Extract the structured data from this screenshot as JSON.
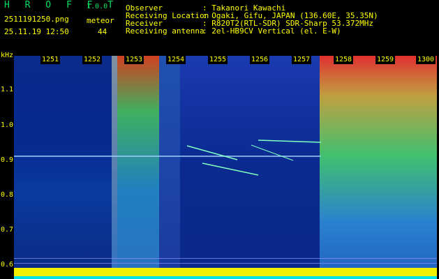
{
  "header": {
    "app_title": "H R O F F T",
    "version": "1.0.0",
    "filename": "2511191250.png",
    "mode": "meteor",
    "datetime": "25.11.19 12:50",
    "count": "44",
    "observer_label": "Observer",
    "observer_value": ": Takanori Kawachi",
    "location_label": "Receiving Location",
    "location_value": ": Ogaki, Gifu, JAPAN (136.60E, 35.35N)",
    "receiver_label": "Receiver",
    "receiver_value": ": R820T2(RTL-SDR) SDR-Sharp 53.372MHz",
    "antenna_label": "Receiving antenna",
    "antenna_value": ": 2el-HB9CV Vertical (el. E-W)"
  },
  "axis": {
    "unit": "kHz",
    "y_ticks": [
      "1.1",
      "1.0",
      "0.9",
      "0.8",
      "0.7",
      "0.6"
    ],
    "time_ticks": [
      "1251",
      "1252",
      "1253",
      "1254",
      "1255",
      "1256",
      "1257",
      "1258",
      "1259",
      "1300"
    ]
  },
  "colors": {
    "background": "#000000",
    "text": "#ffff00",
    "title": "#00e060",
    "spectrum_base": "#001a6e"
  }
}
